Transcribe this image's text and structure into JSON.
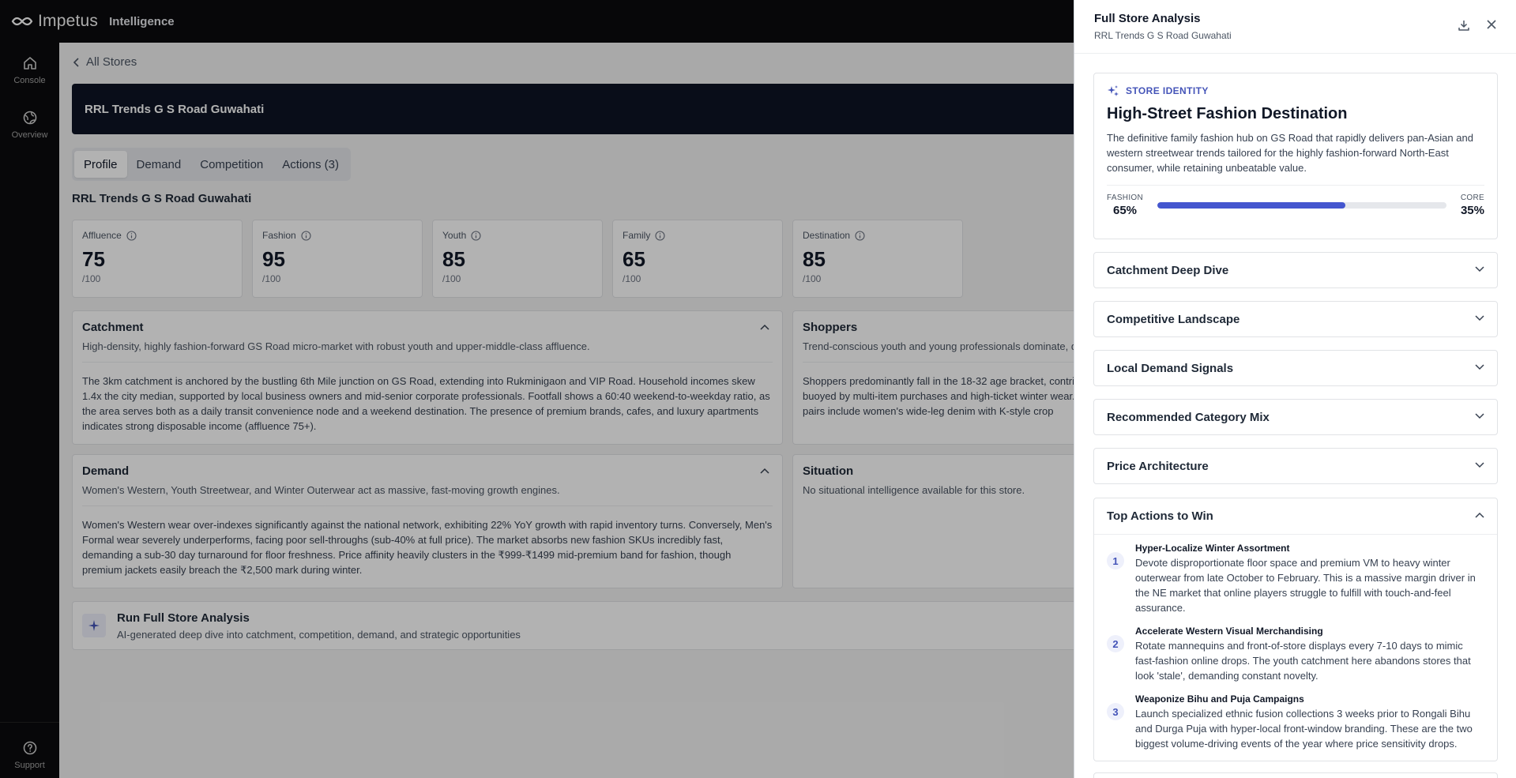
{
  "app": {
    "brand": "Impetus",
    "product": "Intelligence"
  },
  "nav": {
    "console": "Console",
    "overview": "Overview",
    "support": "Support"
  },
  "main": {
    "back_label": "All Stores",
    "hero_title": "RRL Trends G S Road Guwahati",
    "tabs": [
      "Profile",
      "Demand",
      "Competition",
      "Actions (3)"
    ],
    "store_heading": "RRL Trends G S Road Guwahati",
    "metrics": [
      {
        "label": "Affluence",
        "value": "75",
        "denom": "/100"
      },
      {
        "label": "Fashion",
        "value": "95",
        "denom": "/100"
      },
      {
        "label": "Youth",
        "value": "85",
        "denom": "/100"
      },
      {
        "label": "Family",
        "value": "65",
        "denom": "/100"
      },
      {
        "label": "Destination",
        "value": "85",
        "denom": "/100"
      }
    ],
    "catchment": {
      "title": "Catchment",
      "subtitle": "High-density, highly fashion-forward GS Road micro-market with robust youth and upper-middle-class affluence.",
      "body": "The 3km catchment is anchored by the bustling 6th Mile junction on GS Road, extending into Rukminigaon and VIP Road. Household incomes skew 1.4x the city median, supported by local business owners and mid-senior corporate professionals. Footfall shows a 60:40 weekend-to-weekday ratio, as the area serves both as a daily transit convenience node and a weekend destination. The presence of premium brands, cafes, and luxury apartments indicates strong disposable income (affluence 75+)."
    },
    "shoppers": {
      "title": "Shoppers",
      "subtitle": "Trend-conscious youth and young professionals dominate, d",
      "body": "Shoppers predominantly fall in the 18-32 age bracket, contrib buoyed by multi-item purchases and high-ticket winter wear. sell pairs include women's wide-leg denim with K-style crop"
    },
    "demand": {
      "title": "Demand",
      "subtitle": "Women's Western, Youth Streetwear, and Winter Outerwear act as massive, fast-moving growth engines.",
      "body": "Women's Western wear over-indexes significantly against the national network, exhibiting 22% YoY growth with rapid inventory turns. Conversely, Men's Formal wear severely underperforms, facing poor sell-throughs (sub-40% at full price). The market absorbs new fashion SKUs incredibly fast, demanding a sub-30 day turnaround for floor freshness. Price affinity heavily clusters in the ₹999-₹1499 mid-premium band for fashion, though premium jackets easily breach the ₹2,500 mark during winter."
    },
    "situation": {
      "title": "Situation",
      "subtitle": "No situational intelligence available for this store."
    },
    "run": {
      "title": "Run Full Store Analysis",
      "desc": "AI-generated deep dive into catchment, competition, demand, and strategic opportunities"
    }
  },
  "panel": {
    "title": "Full Store Analysis",
    "subtitle": "RRL Trends G S Road Guwahati",
    "identity": {
      "label": "STORE IDENTITY",
      "headline": "High-Street Fashion Destination",
      "desc": "The definitive family fashion hub on GS Road that rapidly delivers pan-Asian and western streetwear trends tailored for the highly fashion-forward North-East consumer, while retaining unbeatable value.",
      "left_key": "FASHION",
      "left_val": "65%",
      "right_key": "CORE",
      "right_val": "35%",
      "fashion_share": 65
    },
    "sections": [
      "Catchment Deep Dive",
      "Competitive Landscape",
      "Local Demand Signals",
      "Recommended Category Mix",
      "Price Architecture"
    ],
    "top_actions": {
      "title": "Top Actions to Win",
      "items": [
        {
          "num": "1",
          "title": "Hyper-Localize Winter Assortment",
          "desc": "Devote disproportionate floor space and premium VM to heavy winter outerwear from late October to February. This is a massive margin driver in the NE market that online players struggle to fulfill with touch-and-feel assurance."
        },
        {
          "num": "2",
          "title": "Accelerate Western Visual Merchandising",
          "desc": "Rotate mannequins and front-of-store displays every 7-10 days to mimic fast-fashion online drops. The youth catchment here abandons stores that look 'stale', demanding constant novelty."
        },
        {
          "num": "3",
          "title": "Weaponize Bihu and Puja Campaigns",
          "desc": "Launch specialized ethnic fusion collections 3 weeks prior to Rongali Bihu and Durga Puja with hyper-local front-window branding. These are the two biggest volume-driving events of the year where price sensitivity drops."
        }
      ]
    }
  }
}
